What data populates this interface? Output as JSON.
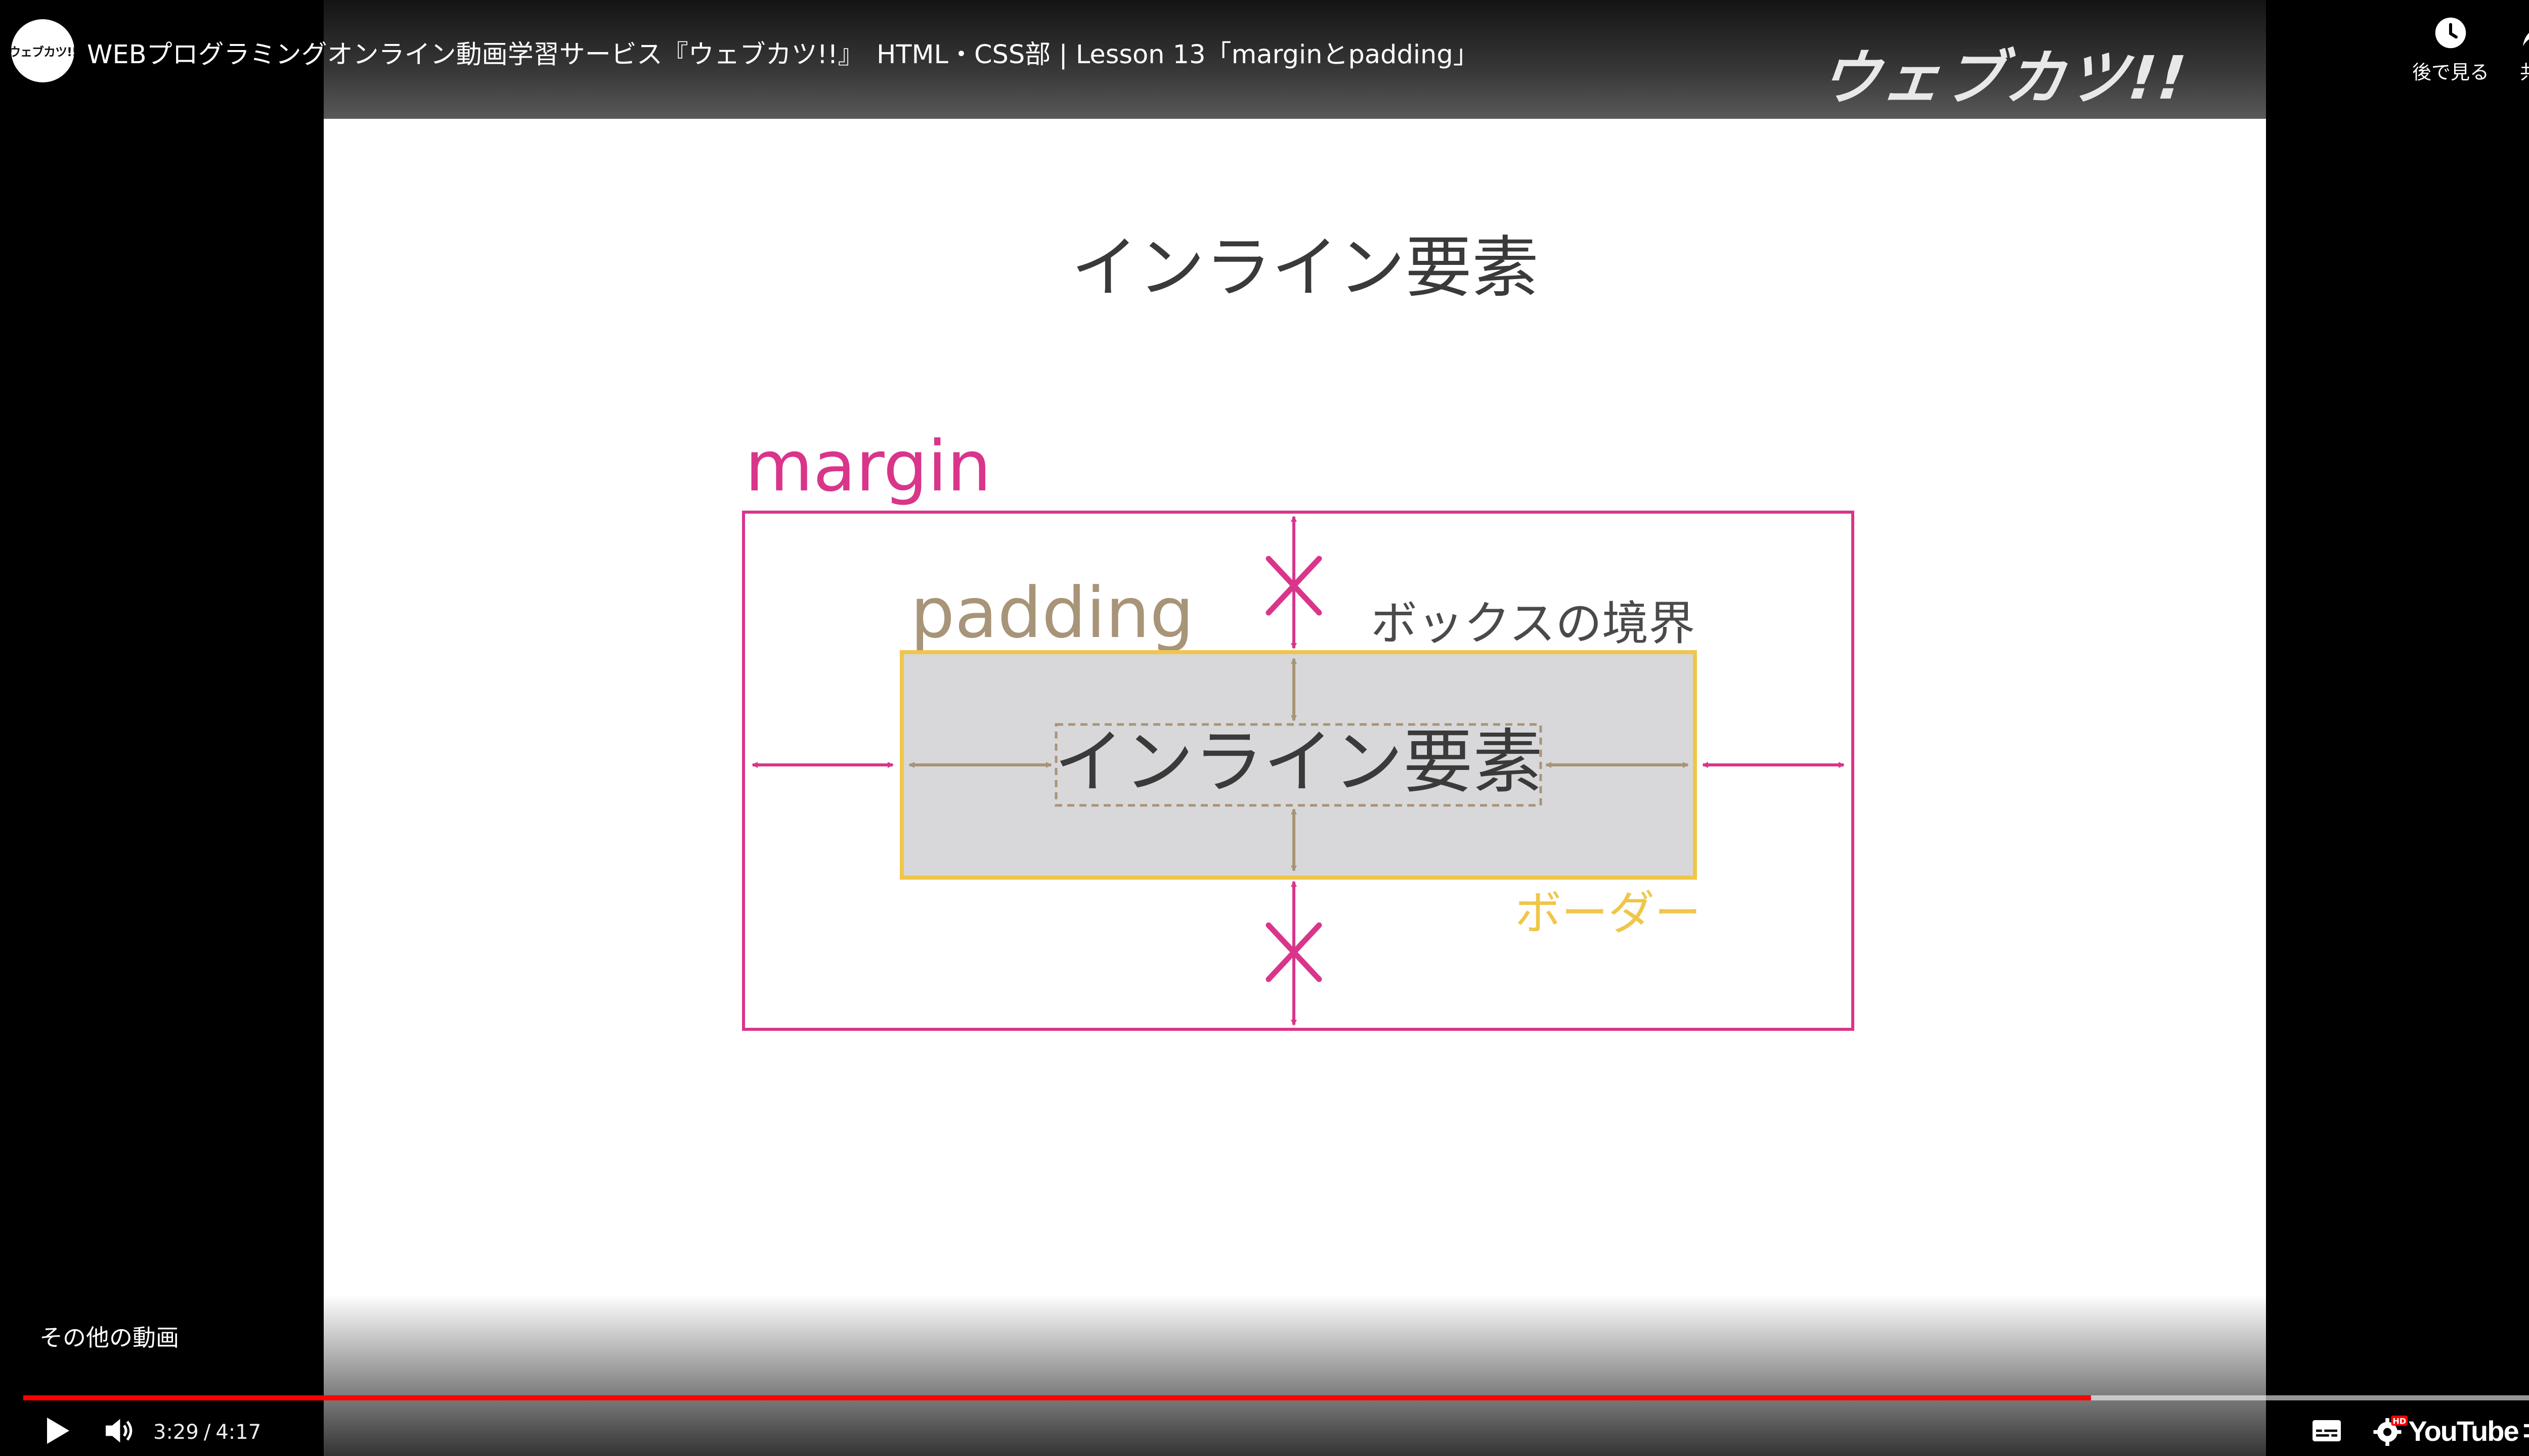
{
  "channel": {
    "avatar_text": "ウェブカツ!!"
  },
  "video": {
    "title": "WEBプログラミングオンライン動画学習サービス『ウェブカツ!!』　HTML・CSS部 | Lesson 13「marginとpadding」",
    "brand_logo_text": "ウェブカツ!!"
  },
  "top_actions": {
    "watch_later_label": "後で見る",
    "share_label": "共有"
  },
  "slide": {
    "title": "インライン要素",
    "margin_label": "margin",
    "padding_label": "padding",
    "box_boundary_label": "ボックスの境界",
    "border_label": "ボーダー",
    "inline_element_text": "インライン要素",
    "colors": {
      "margin": "#d9358a",
      "padding": "#a89478",
      "border": "#f0c64a",
      "inline_box_fill": "#d8d8da",
      "title_text": "#3a3a3a"
    }
  },
  "overlay": {
    "more_videos_label": "その他の動画"
  },
  "player": {
    "current_time": "3:29",
    "separator": "/",
    "duration": "4:17",
    "progress_played_fraction": 0.813,
    "progress_loaded_fraction": 1.0,
    "youtube_label": "YouTube",
    "progress_color": "#ff0000",
    "icons": {
      "play": "play-icon",
      "volume": "volume-icon",
      "subtitles": "subtitles-icon",
      "settings": "settings-hd-icon",
      "exit_fullscreen": "exit-fullscreen-icon",
      "watch_later": "clock-icon",
      "share": "share-arrow-icon"
    }
  }
}
